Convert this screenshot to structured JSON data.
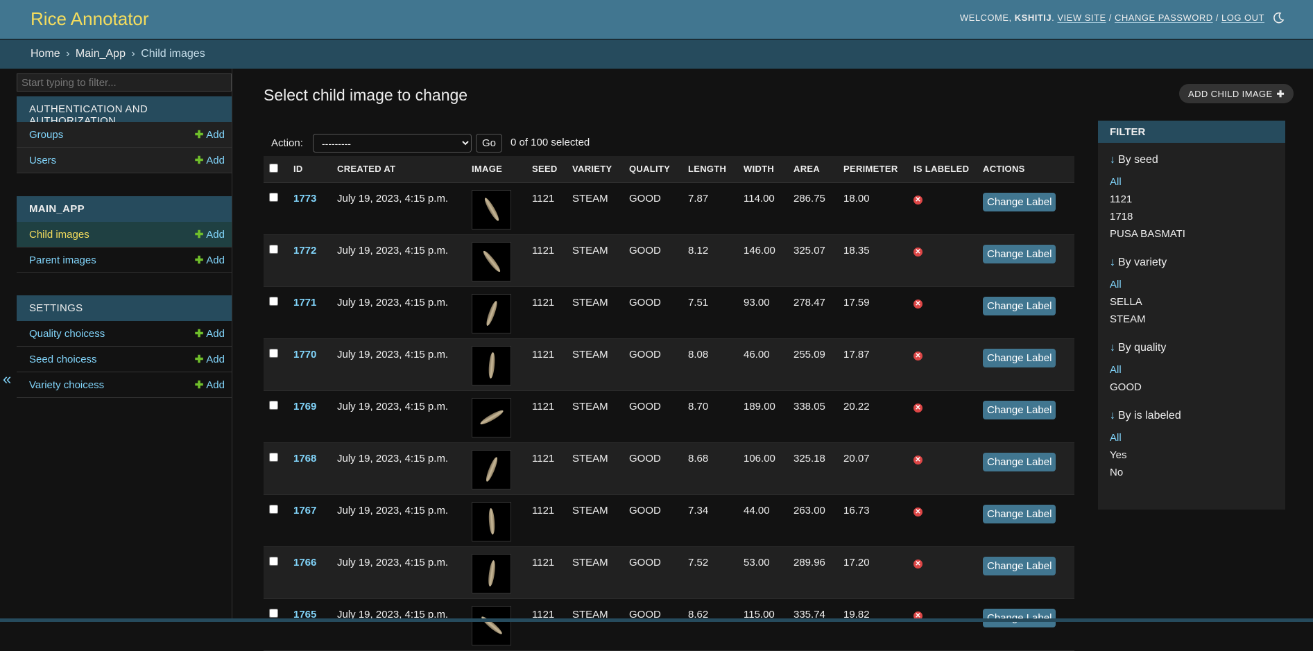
{
  "header": {
    "branding": "Rice Annotator",
    "welcome": "WELCOME,",
    "user": "KSHITIJ",
    "view_site": "VIEW SITE",
    "change_password": "CHANGE PASSWORD",
    "log_out": "LOG OUT",
    "sep": "/",
    "theme_icon": "moon-icon"
  },
  "breadcrumbs": {
    "home": "Home",
    "app": "Main_App",
    "current": "Child images",
    "sep": "›"
  },
  "sidebar": {
    "filter_placeholder": "Start typing to filter...",
    "add_label": "Add",
    "modules": [
      {
        "caption": "AUTHENTICATION AND AUTHORIZATION",
        "items": [
          {
            "name": "Groups"
          },
          {
            "name": "Users"
          }
        ]
      },
      {
        "caption": "MAIN_APP",
        "items": [
          {
            "name": "Child images"
          },
          {
            "name": "Parent images"
          }
        ]
      },
      {
        "caption": "SETTINGS",
        "items": [
          {
            "name": "Quality choicess"
          },
          {
            "name": "Seed choicess"
          },
          {
            "name": "Variety choicess"
          }
        ]
      }
    ],
    "collapse_glyph": "«"
  },
  "content": {
    "title": "Select child image to change",
    "add_button": "ADD CHILD IMAGE",
    "action_label": "Action:",
    "action_option": "---------",
    "go_label": "Go",
    "counter": "0 of 100 selected"
  },
  "table": {
    "columns": [
      "ID",
      "CREATED AT",
      "IMAGE",
      "SEED",
      "VARIETY",
      "QUALITY",
      "LENGTH",
      "WIDTH",
      "AREA",
      "PERIMETER",
      "IS LABELED",
      "ACTIONS"
    ],
    "action_label": "Change Label",
    "rows": [
      {
        "id": "1773",
        "created": "July 19, 2023, 4:15 p.m.",
        "seed": "1121",
        "variety": "STEAM",
        "quality": "GOOD",
        "length": "7.87",
        "width": "114.00",
        "area": "286.75",
        "perimeter": "18.00",
        "labeled": false
      },
      {
        "id": "1772",
        "created": "July 19, 2023, 4:15 p.m.",
        "seed": "1121",
        "variety": "STEAM",
        "quality": "GOOD",
        "length": "8.12",
        "width": "146.00",
        "area": "325.07",
        "perimeter": "18.35",
        "labeled": false
      },
      {
        "id": "1771",
        "created": "July 19, 2023, 4:15 p.m.",
        "seed": "1121",
        "variety": "STEAM",
        "quality": "GOOD",
        "length": "7.51",
        "width": "93.00",
        "area": "278.47",
        "perimeter": "17.59",
        "labeled": false
      },
      {
        "id": "1770",
        "created": "July 19, 2023, 4:15 p.m.",
        "seed": "1121",
        "variety": "STEAM",
        "quality": "GOOD",
        "length": "8.08",
        "width": "46.00",
        "area": "255.09",
        "perimeter": "17.87",
        "labeled": false
      },
      {
        "id": "1769",
        "created": "July 19, 2023, 4:15 p.m.",
        "seed": "1121",
        "variety": "STEAM",
        "quality": "GOOD",
        "length": "8.70",
        "width": "189.00",
        "area": "338.05",
        "perimeter": "20.22",
        "labeled": false
      },
      {
        "id": "1768",
        "created": "July 19, 2023, 4:15 p.m.",
        "seed": "1121",
        "variety": "STEAM",
        "quality": "GOOD",
        "length": "8.68",
        "width": "106.00",
        "area": "325.18",
        "perimeter": "20.07",
        "labeled": false
      },
      {
        "id": "1767",
        "created": "July 19, 2023, 4:15 p.m.",
        "seed": "1121",
        "variety": "STEAM",
        "quality": "GOOD",
        "length": "7.34",
        "width": "44.00",
        "area": "263.00",
        "perimeter": "16.73",
        "labeled": false
      },
      {
        "id": "1766",
        "created": "July 19, 2023, 4:15 p.m.",
        "seed": "1121",
        "variety": "STEAM",
        "quality": "GOOD",
        "length": "7.52",
        "width": "53.00",
        "area": "289.96",
        "perimeter": "17.20",
        "labeled": false
      },
      {
        "id": "1765",
        "created": "July 19, 2023, 4:15 p.m.",
        "seed": "1121",
        "variety": "STEAM",
        "quality": "GOOD",
        "length": "8.62",
        "width": "115.00",
        "area": "335.74",
        "perimeter": "19.82",
        "labeled": false
      }
    ]
  },
  "filter": {
    "title": "FILTER",
    "groups": [
      {
        "heading": "By seed",
        "options": [
          "All",
          "1121",
          "1718",
          "PUSA BASMATI"
        ]
      },
      {
        "heading": "By variety",
        "options": [
          "All",
          "SELLA",
          "STEAM"
        ]
      },
      {
        "heading": "By quality",
        "options": [
          "All",
          "GOOD"
        ]
      },
      {
        "heading": "By is labeled",
        "options": [
          "All",
          "Yes",
          "No"
        ]
      }
    ]
  },
  "colors": {
    "header_bg": "#417690",
    "breadcrumb_bg": "#264b5d",
    "branding": "#f5dd5d",
    "link": "#81d4fa",
    "add_plus": "#70bf2b",
    "no_icon": "#dd4646"
  }
}
